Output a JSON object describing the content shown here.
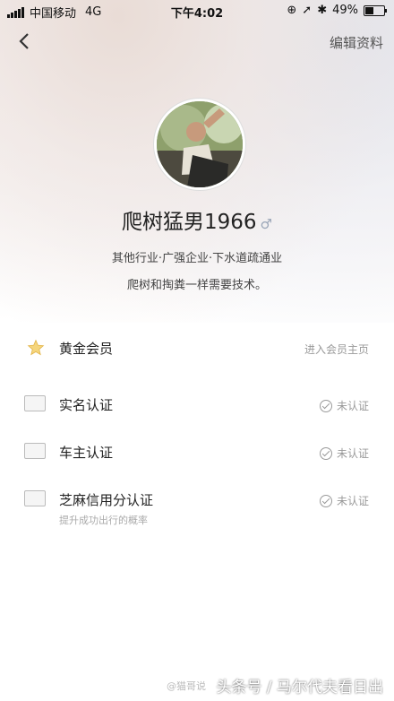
{
  "status": {
    "carrier": "中国移动",
    "network": "4G",
    "time": "下午4:02",
    "battery": "49%",
    "battery_level": 0.49
  },
  "nav": {
    "edit_label": "编辑资料"
  },
  "profile": {
    "name": "爬树猛男1966",
    "gender_symbol": "♂",
    "tags": "其他行业·广强企业·下水道疏通业",
    "bio": "爬树和掏粪一样需要技术。"
  },
  "items": [
    {
      "label": "黄金会员",
      "action": "进入会员主页",
      "icon": "star-icon"
    },
    {
      "label": "实名认证",
      "status": "未认证",
      "icon": "id-card-icon"
    },
    {
      "label": "车主认证",
      "status": "未认证",
      "icon": "car-card-icon"
    },
    {
      "label": "芝麻信用分认证",
      "status": "未认证",
      "sub": "提升成功出行的概率",
      "icon": "sesame-credit-icon"
    }
  ],
  "footer": {
    "watermark": "@猫哥说",
    "caption": "头条号 / 马尔代夫看日出"
  }
}
